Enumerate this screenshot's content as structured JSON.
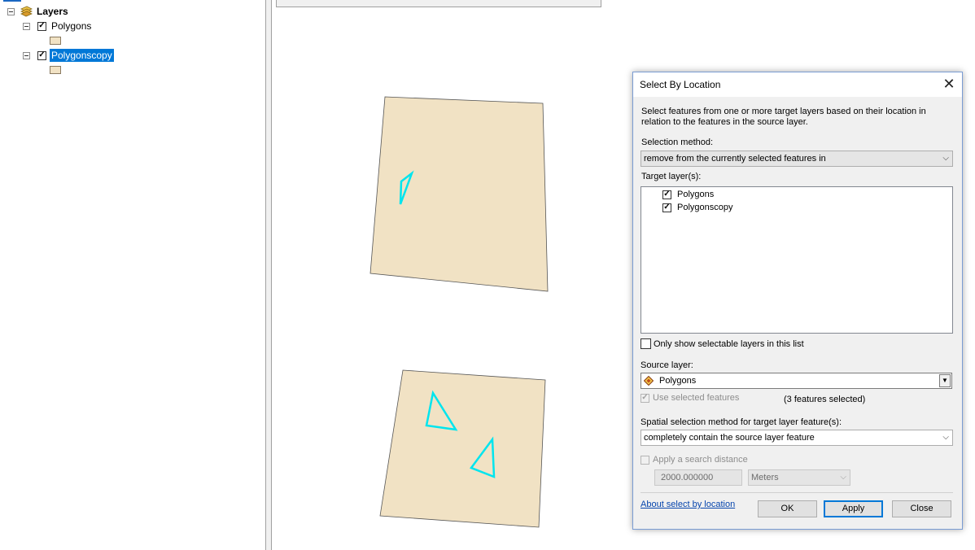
{
  "toc": {
    "root_label": "Layers",
    "layers": [
      {
        "name": "Polygons",
        "checked": true,
        "selected": false
      },
      {
        "name": "Polygonscopy",
        "checked": true,
        "selected": true
      }
    ]
  },
  "dialog": {
    "title": "Select By Location",
    "description_line1": "Select features from one or more target layers based on their location in",
    "description_line2": "relation to the features in the source layer.",
    "selection_method_label": "Selection method:",
    "selection_method_value": "remove from the currently selected features in",
    "target_layers_label": "Target layer(s):",
    "target_layers": [
      {
        "name": "Polygons",
        "checked": true
      },
      {
        "name": "Polygonscopy",
        "checked": true
      }
    ],
    "only_selectable_label": "Only show selectable layers in this list",
    "source_layer_label": "Source layer:",
    "source_layer_value": "Polygons",
    "use_selected_label": "Use selected features",
    "features_selected": "(3 features selected)",
    "spatial_method_label": "Spatial selection method for target layer feature(s):",
    "spatial_method_value": "completely contain the source layer feature",
    "search_distance_label": "Apply a search distance",
    "search_distance_value": "2000.000000",
    "search_distance_unit": "Meters",
    "about_link": "About select by location",
    "ok_label": "OK",
    "apply_label": "Apply",
    "close_label": "Close"
  },
  "colors": {
    "polygon_fill": "#f1e2c4",
    "selection_outline": "#00e5ee",
    "accent": "#0078d7"
  }
}
